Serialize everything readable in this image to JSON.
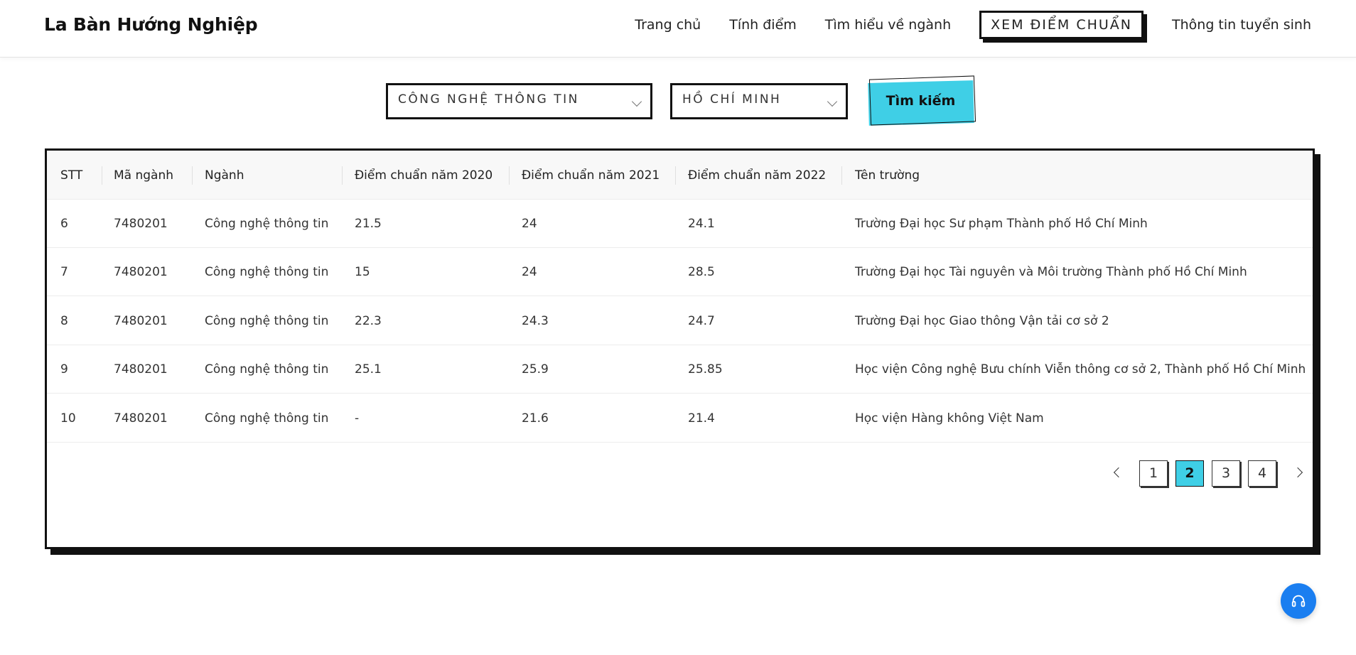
{
  "brand": "La Bàn Hướng Nghiệp",
  "nav": [
    {
      "label": "Trang chủ"
    },
    {
      "label": "Tính điểm"
    },
    {
      "label": "Tìm hiểu về ngành"
    },
    {
      "label": "XEM ĐIỂM CHUẨN",
      "active": true
    },
    {
      "label": "Thông tin tuyển sinh"
    }
  ],
  "search": {
    "major_value": "CÔNG NGHỆ THÔNG TIN",
    "city_value": "HỒ CHÍ MINH",
    "button_label": "Tìm kiếm"
  },
  "table": {
    "headers": [
      "STT",
      "Mã ngành",
      "Ngành",
      "Điểm chuẩn năm 2020",
      "Điểm chuẩn năm 2021",
      "Điểm chuẩn năm 2022",
      "Tên trường"
    ],
    "rows": [
      [
        "6",
        "7480201",
        "Công nghệ thông tin",
        "21.5",
        "24",
        "24.1",
        "Trường Đại học Sư phạm Thành phố Hồ Chí Minh"
      ],
      [
        "7",
        "7480201",
        "Công nghệ thông tin",
        "15",
        "24",
        "28.5",
        "Trường Đại học Tài nguyên và Môi trường Thành phố Hồ Chí Minh"
      ],
      [
        "8",
        "7480201",
        "Công nghệ thông tin",
        "22.3",
        "24.3",
        "24.7",
        "Trường Đại học Giao thông Vận tải cơ sở 2"
      ],
      [
        "9",
        "7480201",
        "Công nghệ thông tin",
        "25.1",
        "25.9",
        "25.85",
        "Học viện Công nghệ Bưu chính Viễn thông cơ sở 2, Thành phố Hồ Chí Minh"
      ],
      [
        "10",
        "7480201",
        "Công nghệ thông tin",
        "-",
        "21.6",
        "21.4",
        "Học viện Hàng không Việt Nam"
      ]
    ]
  },
  "pagination": {
    "pages": [
      "1",
      "2",
      "3",
      "4"
    ],
    "current": "2"
  },
  "colors": {
    "accent": "#3fcfe6",
    "support": "#1a7ef0",
    "border": "#111111"
  },
  "icons": {
    "support": "headset-icon",
    "dropdown": "chevron-down-icon",
    "prev": "chevron-left-icon",
    "next": "chevron-right-icon"
  }
}
